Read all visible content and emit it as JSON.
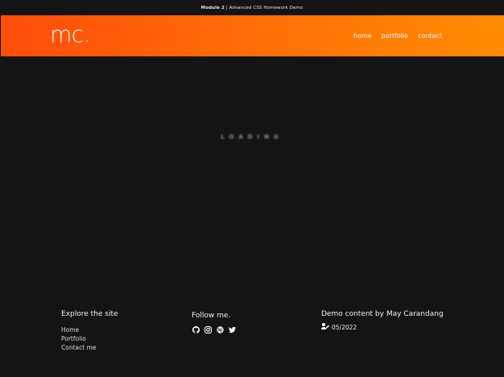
{
  "topbar": {
    "title_bold": "Module 2",
    "title_rest": " | Advanced CSS Homework Demo"
  },
  "header": {
    "logo": "mc.",
    "nav": [
      "home",
      "portfolio",
      "contact"
    ]
  },
  "main": {
    "loading_text": "LOADING"
  },
  "footer": {
    "explore": {
      "heading": "Explore the site",
      "links": [
        "Home",
        "Portfolio",
        "Contact me"
      ]
    },
    "follow": {
      "heading": "Follow me.",
      "icons": [
        "github-icon",
        "instagram-icon",
        "dribbble-icon",
        "twitter-icon"
      ]
    },
    "credit": {
      "heading": "Demo content by May Carandang",
      "date": "05/2022",
      "icon": "user-edit-icon"
    }
  },
  "colors": {
    "background": "#141414",
    "gradient_start": "#ff4d0a",
    "gradient_end": "#ff8c02",
    "text": "#ffffff"
  }
}
